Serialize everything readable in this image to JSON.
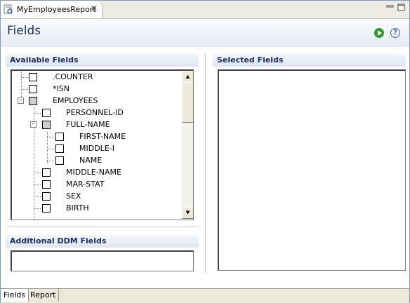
{
  "editor": {
    "tab_title": "MyEmployeesReport"
  },
  "page": {
    "title": "Fields"
  },
  "available": {
    "heading": "Available Fields",
    "items": [
      {
        "label": ".COUNTER",
        "state": "unchecked"
      },
      {
        "label": "*ISN",
        "state": "unchecked"
      },
      {
        "label": "EMPLOYEES",
        "state": "partial",
        "expanded": true
      },
      {
        "label": "PERSONNEL-ID",
        "state": "unchecked"
      },
      {
        "label": "FULL-NAME",
        "state": "partial",
        "expanded": true
      },
      {
        "label": "FIRST-NAME",
        "state": "unchecked"
      },
      {
        "label": "MIDDLE-I",
        "state": "unchecked"
      },
      {
        "label": "NAME",
        "state": "unchecked"
      },
      {
        "label": "MIDDLE-NAME",
        "state": "unchecked"
      },
      {
        "label": "MAR-STAT",
        "state": "unchecked"
      },
      {
        "label": "SEX",
        "state": "unchecked"
      },
      {
        "label": "BIRTH",
        "state": "unchecked"
      }
    ]
  },
  "additional": {
    "heading": "Additional DDM Fields"
  },
  "selected": {
    "heading": "Selected Fields"
  },
  "bottom_tabs": [
    {
      "label": "Fields"
    },
    {
      "label": "Report"
    }
  ],
  "icons": {
    "run": "run-icon",
    "help": "help-icon"
  },
  "colors": {
    "title": "#1b2f5e",
    "run": "#2a9b2e"
  }
}
